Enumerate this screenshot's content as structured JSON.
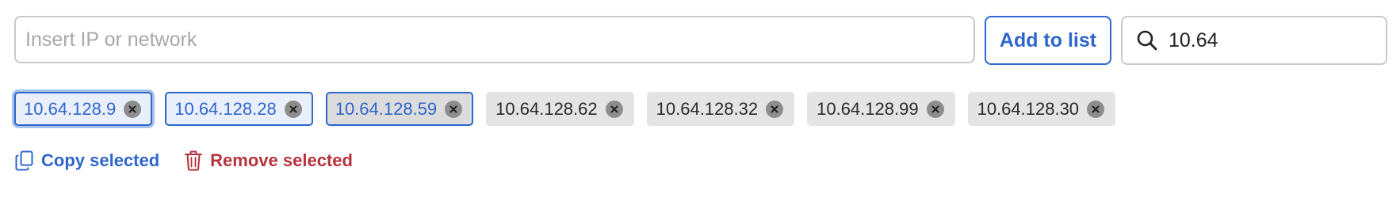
{
  "ip_input": {
    "placeholder": "Insert IP or network",
    "value": ""
  },
  "add_button": {
    "label": "Add to list"
  },
  "search": {
    "value": "10.64",
    "icon": "search-icon"
  },
  "chips": [
    {
      "label": "10.64.128.9",
      "selected": true
    },
    {
      "label": "10.64.128.28",
      "selected": true
    },
    {
      "label": "10.64.128.59",
      "selected": true
    },
    {
      "label": "10.64.128.62",
      "selected": false
    },
    {
      "label": "10.64.128.32",
      "selected": false
    },
    {
      "label": "10.64.128.99",
      "selected": false
    },
    {
      "label": "10.64.128.30",
      "selected": false
    }
  ],
  "actions": {
    "copy_label": "Copy selected",
    "remove_label": "Remove selected"
  },
  "colors": {
    "accent": "#2f66cc",
    "danger": "#b5333e",
    "chip_bg": "#e4e4e4",
    "border": "#c9c9c9"
  }
}
